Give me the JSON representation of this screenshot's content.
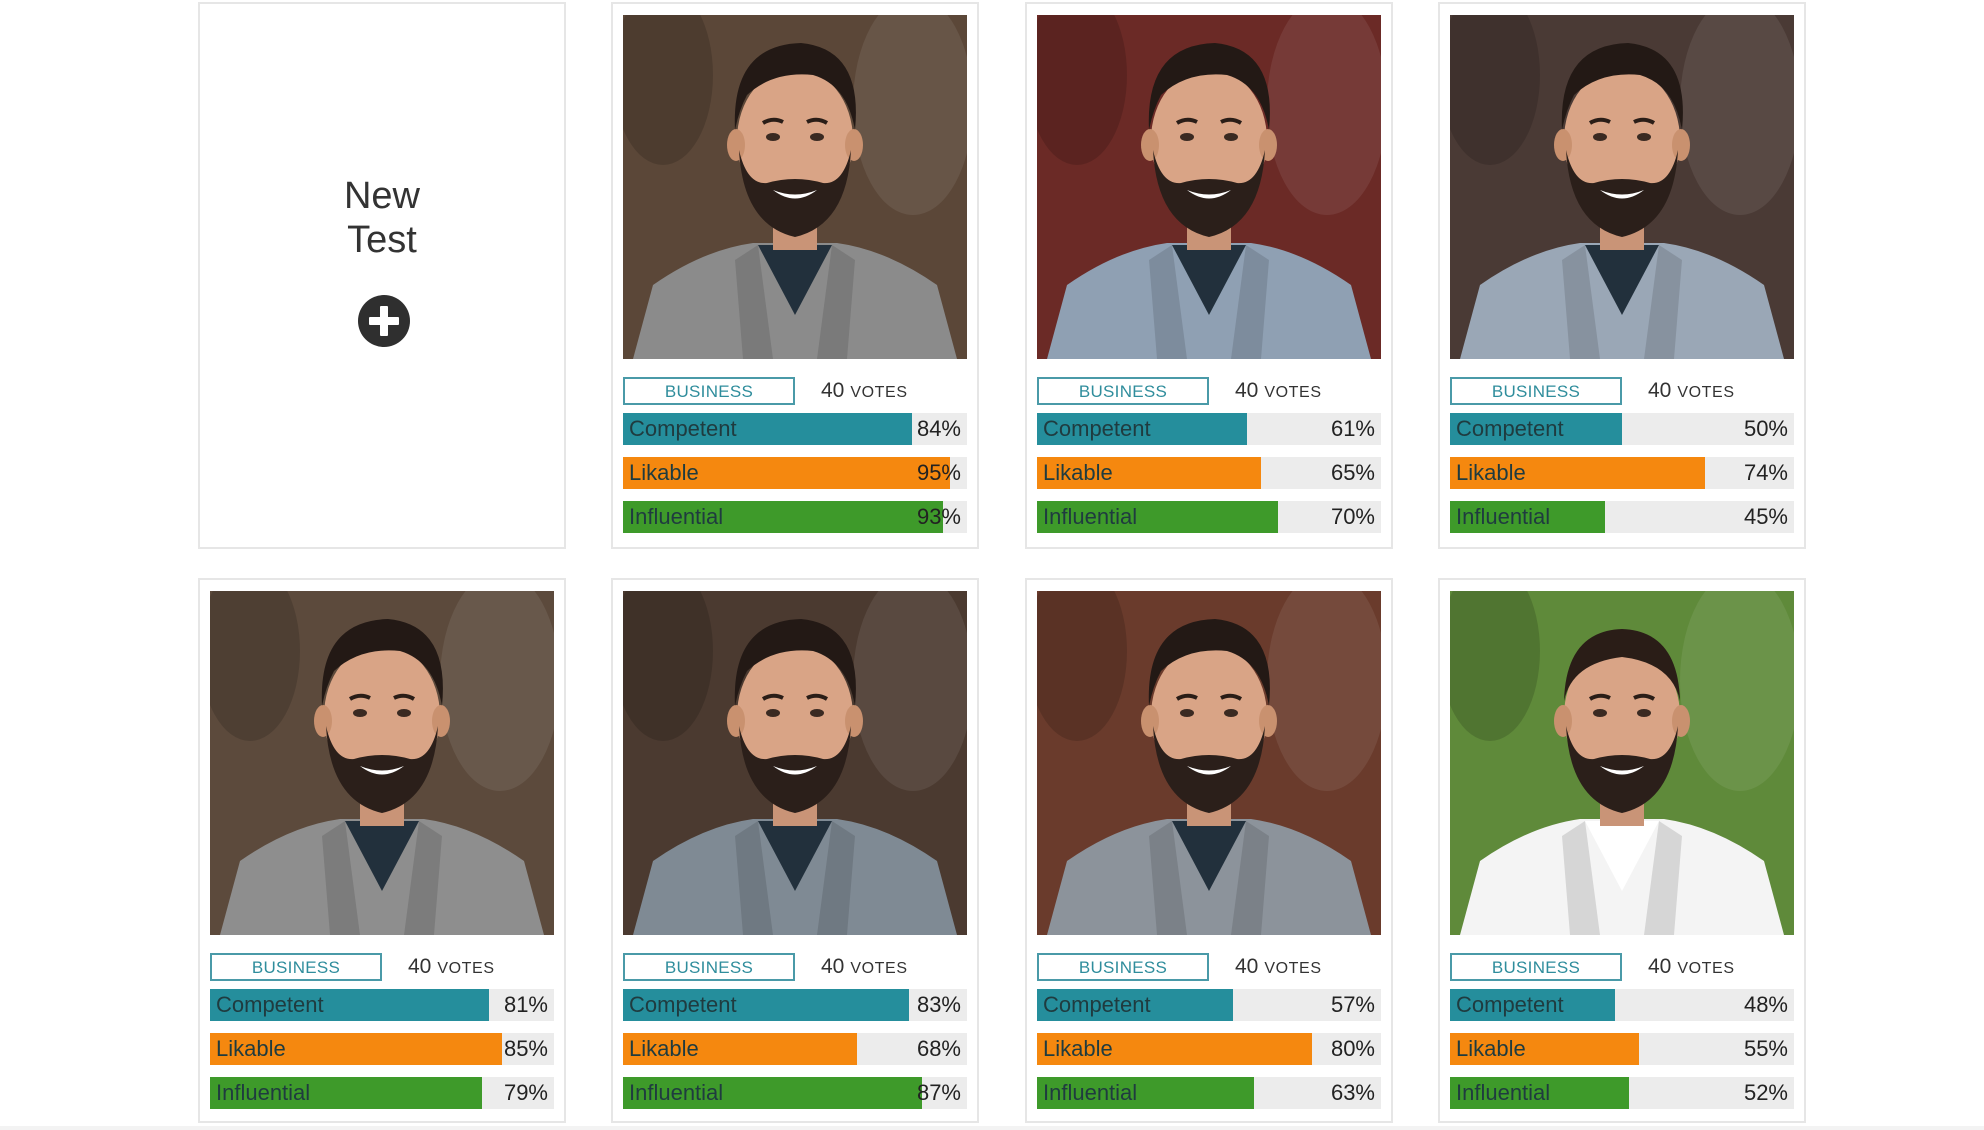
{
  "new_test": {
    "line1": "New",
    "line2": "Test"
  },
  "colors": {
    "competent": "#258e9c",
    "likable": "#f5880f",
    "influential": "#3e9a2a",
    "track": "#ececec"
  },
  "cards": [
    {
      "tag": "BUSINESS",
      "votes_number": "40",
      "votes_label": "VOTES",
      "bg": "#5b4738",
      "suit": "#8b8b8b",
      "hairstyle": "slick",
      "metrics": [
        {
          "label": "Competent",
          "value": 84,
          "text": "84%"
        },
        {
          "label": "Likable",
          "value": 95,
          "text": "95%"
        },
        {
          "label": "Influential",
          "value": 93,
          "text": "93%"
        }
      ]
    },
    {
      "tag": "BUSINESS",
      "votes_number": "40",
      "votes_label": "VOTES",
      "bg": "#6b2a26",
      "suit": "#8fa0b3",
      "hairstyle": "slick",
      "metrics": [
        {
          "label": "Competent",
          "value": 61,
          "text": "61%"
        },
        {
          "label": "Likable",
          "value": 65,
          "text": "65%"
        },
        {
          "label": "Influential",
          "value": 70,
          "text": "70%"
        }
      ]
    },
    {
      "tag": "BUSINESS",
      "votes_number": "40",
      "votes_label": "VOTES",
      "bg": "#4a3a35",
      "suit": "#9aa7b6",
      "hairstyle": "slick",
      "metrics": [
        {
          "label": "Competent",
          "value": 50,
          "text": "50%"
        },
        {
          "label": "Likable",
          "value": 74,
          "text": "74%"
        },
        {
          "label": "Influential",
          "value": 45,
          "text": "45%"
        }
      ]
    },
    {
      "tag": "BUSINESS",
      "votes_number": "40",
      "votes_label": "VOTES",
      "bg": "#5c4a3c",
      "suit": "#8e8e8e",
      "hairstyle": "slick",
      "metrics": [
        {
          "label": "Competent",
          "value": 81,
          "text": "81%"
        },
        {
          "label": "Likable",
          "value": 85,
          "text": "85%"
        },
        {
          "label": "Influential",
          "value": 79,
          "text": "79%"
        }
      ]
    },
    {
      "tag": "BUSINESS",
      "votes_number": "40",
      "votes_label": "VOTES",
      "bg": "#4b3a30",
      "suit": "#7f8a94",
      "hairstyle": "slick",
      "metrics": [
        {
          "label": "Competent",
          "value": 83,
          "text": "83%"
        },
        {
          "label": "Likable",
          "value": 68,
          "text": "68%"
        },
        {
          "label": "Influential",
          "value": 87,
          "text": "87%"
        }
      ]
    },
    {
      "tag": "BUSINESS",
      "votes_number": "40",
      "votes_label": "VOTES",
      "bg": "#6a3b2c",
      "suit": "#8c939b",
      "hairstyle": "slick",
      "metrics": [
        {
          "label": "Competent",
          "value": 57,
          "text": "57%"
        },
        {
          "label": "Likable",
          "value": 80,
          "text": "80%"
        },
        {
          "label": "Influential",
          "value": 63,
          "text": "63%"
        }
      ]
    },
    {
      "tag": "BUSINESS",
      "votes_number": "40",
      "votes_label": "VOTES",
      "bg": "#5f8a3a",
      "suit": "#f4f4f4",
      "hairstyle": "short",
      "metrics": [
        {
          "label": "Competent",
          "value": 48,
          "text": "48%"
        },
        {
          "label": "Likable",
          "value": 55,
          "text": "55%"
        },
        {
          "label": "Influential",
          "value": 52,
          "text": "52%"
        }
      ]
    }
  ]
}
